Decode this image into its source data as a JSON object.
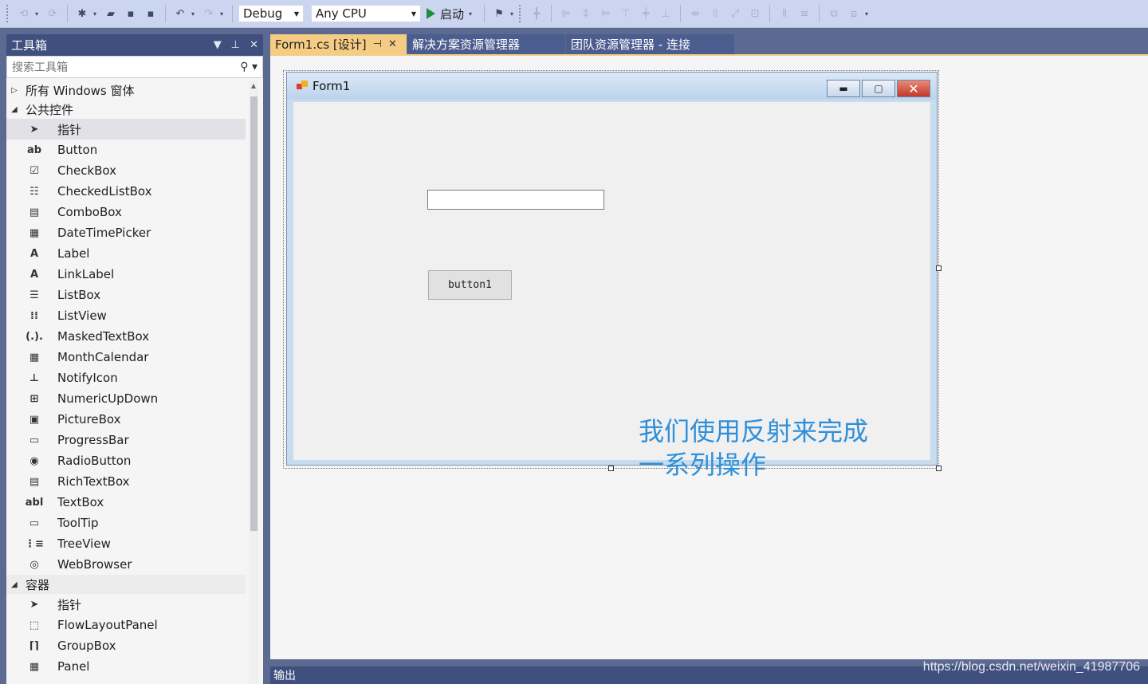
{
  "toolbar": {
    "config_select": "Debug",
    "platform_select": "Any CPU",
    "start_label": "启动"
  },
  "toolbox": {
    "title": "工具箱",
    "search_placeholder": "搜索工具箱",
    "groups": [
      {
        "label": "所有 Windows 窗体",
        "expanded": false
      },
      {
        "label": "公共控件",
        "expanded": true
      },
      {
        "label": "容器",
        "expanded": true
      }
    ],
    "common_items": [
      {
        "label": "指针",
        "icon": "pointer-icon",
        "glyph": "➤"
      },
      {
        "label": "Button",
        "icon": "button-icon",
        "glyph": "ab"
      },
      {
        "label": "CheckBox",
        "icon": "checkbox-icon",
        "glyph": "☑"
      },
      {
        "label": "CheckedListBox",
        "icon": "checkedlistbox-icon",
        "glyph": "☷"
      },
      {
        "label": "ComboBox",
        "icon": "combobox-icon",
        "glyph": "▤"
      },
      {
        "label": "DateTimePicker",
        "icon": "datetimepicker-icon",
        "glyph": "▦"
      },
      {
        "label": "Label",
        "icon": "label-icon",
        "glyph": "A"
      },
      {
        "label": "LinkLabel",
        "icon": "linklabel-icon",
        "glyph": "A"
      },
      {
        "label": "ListBox",
        "icon": "listbox-icon",
        "glyph": "☰"
      },
      {
        "label": "ListView",
        "icon": "listview-icon",
        "glyph": "⁞⁞"
      },
      {
        "label": "MaskedTextBox",
        "icon": "maskedtextbox-icon",
        "glyph": "(.)."
      },
      {
        "label": "MonthCalendar",
        "icon": "monthcalendar-icon",
        "glyph": "▦"
      },
      {
        "label": "NotifyIcon",
        "icon": "notifyicon-icon",
        "glyph": "⊥"
      },
      {
        "label": "NumericUpDown",
        "icon": "numericupdown-icon",
        "glyph": "⊞"
      },
      {
        "label": "PictureBox",
        "icon": "picturebox-icon",
        "glyph": "▣"
      },
      {
        "label": "ProgressBar",
        "icon": "progressbar-icon",
        "glyph": "▭"
      },
      {
        "label": "RadioButton",
        "icon": "radiobutton-icon",
        "glyph": "◉"
      },
      {
        "label": "RichTextBox",
        "icon": "richtextbox-icon",
        "glyph": "▤"
      },
      {
        "label": "TextBox",
        "icon": "textbox-icon",
        "glyph": "abl"
      },
      {
        "label": "ToolTip",
        "icon": "tooltip-icon",
        "glyph": "▭"
      },
      {
        "label": "TreeView",
        "icon": "treeview-icon",
        "glyph": "⋮≡"
      },
      {
        "label": "WebBrowser",
        "icon": "webbrowser-icon",
        "glyph": "◎"
      }
    ],
    "container_items": [
      {
        "label": "指针",
        "icon": "pointer-icon",
        "glyph": "➤"
      },
      {
        "label": "FlowLayoutPanel",
        "icon": "flowlayoutpanel-icon",
        "glyph": "⬚"
      },
      {
        "label": "GroupBox",
        "icon": "groupbox-icon",
        "glyph": "⌈⌉"
      },
      {
        "label": "Panel",
        "icon": "panel-icon",
        "glyph": "▦"
      }
    ]
  },
  "tabs": [
    {
      "label": "Form1.cs [设计]",
      "active": true
    },
    {
      "label": "解决方案资源管理器",
      "active": false
    },
    {
      "label": "团队资源管理器 - 连接",
      "active": false
    }
  ],
  "form": {
    "title": "Form1",
    "button_label": "button1",
    "textbox_value": "",
    "caption_line1": "我们使用反射来完成",
    "caption_line2": "一系列操作"
  },
  "output": {
    "label": "输出"
  },
  "watermark": "https://blog.csdn.net/weixin_41987706",
  "colors": {
    "accent_tab": "#f5cc84",
    "chrome_dark": "#3f4f7e",
    "caption_blue": "#2f8fd8"
  }
}
